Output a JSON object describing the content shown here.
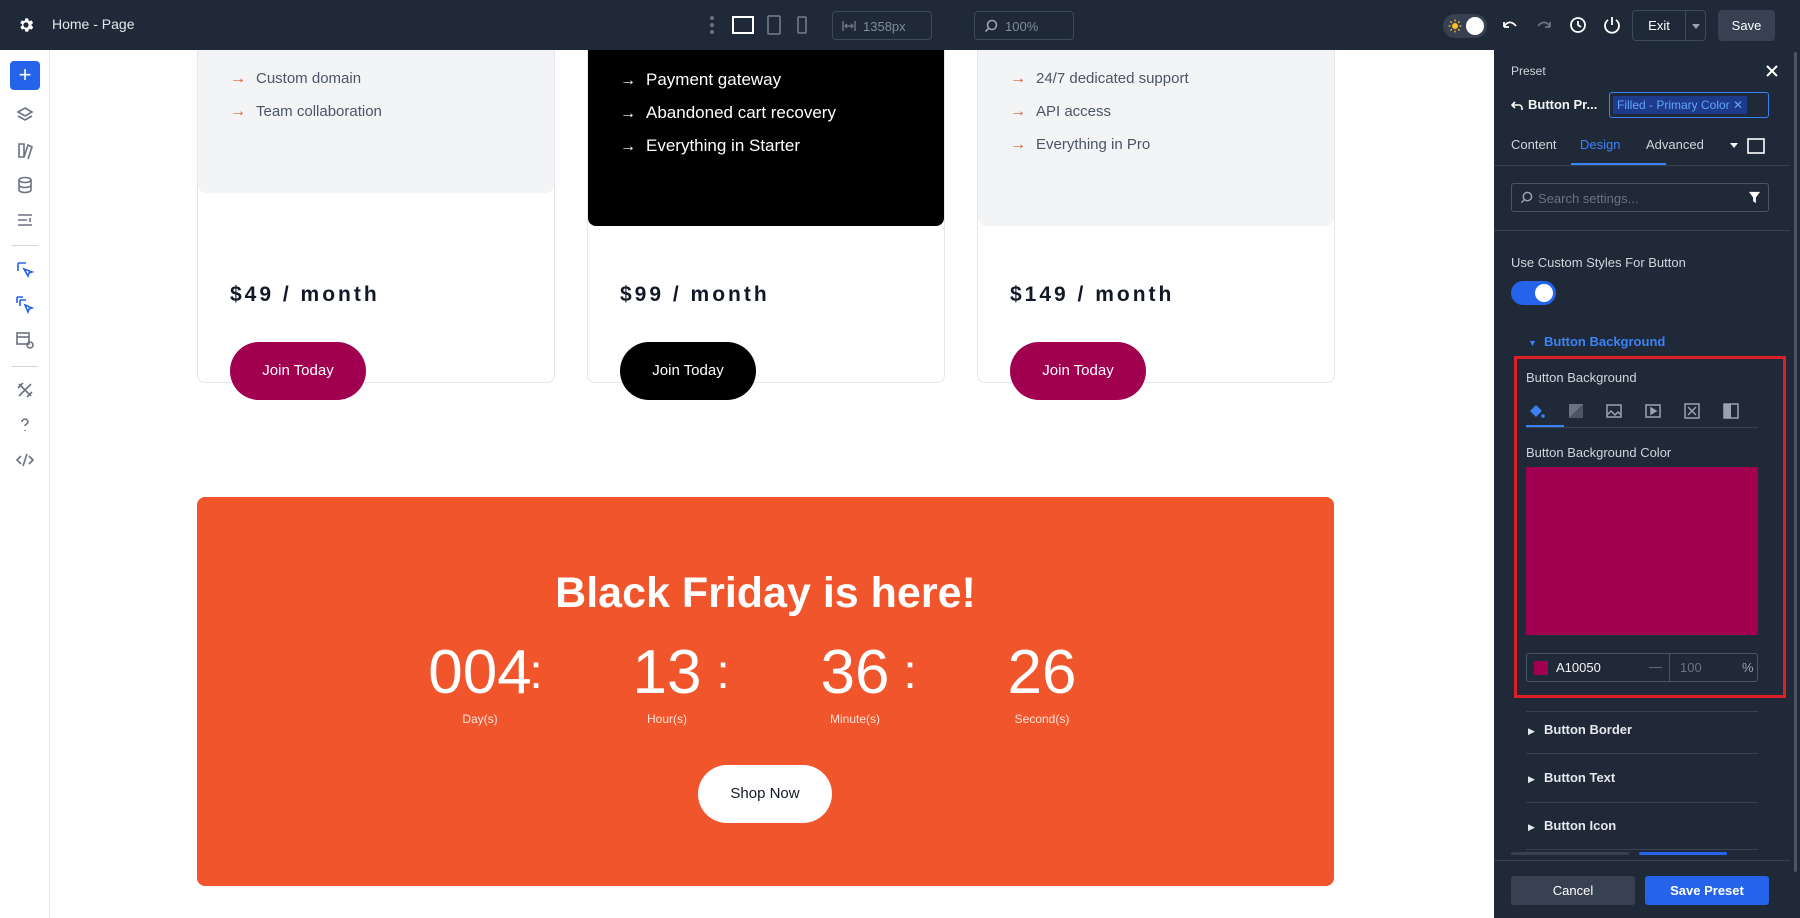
{
  "topbar": {
    "title": "Home - Page",
    "width_value": "1358px",
    "zoom_value": "100%",
    "exit_label": "Exit",
    "save_label": "Save"
  },
  "cards": [
    {
      "features": [
        "Custom domain",
        "Team collaboration"
      ],
      "price": "$49 / month",
      "button": "Join Today",
      "theme": "light",
      "button_color": "#a10050"
    },
    {
      "features": [
        "Payment gateway",
        "Abandoned cart recovery",
        "Everything in Starter"
      ],
      "price": "$99 / month",
      "button": "Join Today",
      "theme": "dark",
      "button_color": "#000000"
    },
    {
      "features": [
        "24/7 dedicated support",
        "API access",
        "Everything in Pro"
      ],
      "price": "$149 / month",
      "button": "Join Today",
      "theme": "light",
      "button_color": "#a10050"
    }
  ],
  "promo": {
    "title": "Black Friday is here!",
    "countdown": [
      {
        "value": "004",
        "label": "Day(s)"
      },
      {
        "value": "13",
        "label": "Hour(s)"
      },
      {
        "value": "36",
        "label": "Minute(s)"
      },
      {
        "value": "26",
        "label": "Second(s)"
      }
    ],
    "separator": ":",
    "button": "Shop Now",
    "background": "#f0552c"
  },
  "panel": {
    "title": "Preset",
    "breadcrumb": "Button Pr...",
    "preset_tag": "Filled - Primary Color",
    "tabs": [
      "Content",
      "Design",
      "Advanced"
    ],
    "active_tab": "Design",
    "search_placeholder": "Search settings...",
    "custom_styles_label": "Use Custom Styles For Button",
    "custom_styles_on": true,
    "section_open": "Button Background",
    "bg_label": "Button Background",
    "bg_color_label": "Button Background Color",
    "color_hex": "A10050",
    "color_value": "#a10050",
    "opacity": "100",
    "opacity_unit": "%",
    "sections": [
      "Button Border",
      "Button Text",
      "Button Icon"
    ],
    "cancel_label": "Cancel",
    "save_preset_label": "Save Preset"
  },
  "colors": {
    "accent": "#2563eb",
    "highlight": "#dc1f26",
    "brand": "#a10050"
  }
}
